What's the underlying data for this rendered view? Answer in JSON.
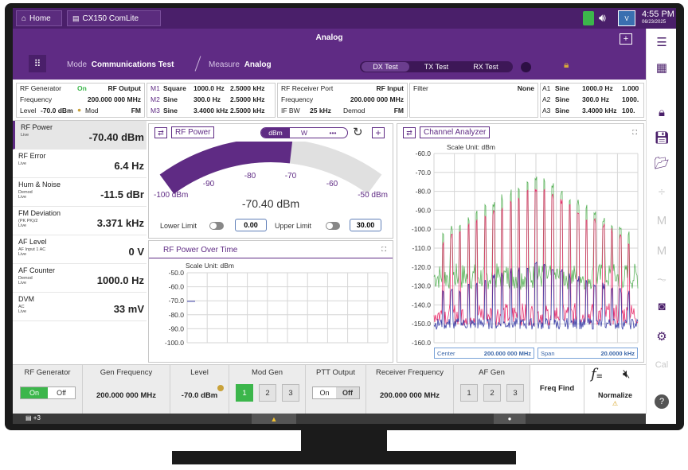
{
  "header": {
    "home_label": "Home",
    "app_tab_label": "CX150 ComLite",
    "time": "4:55 PM",
    "date": "06/23/2025"
  },
  "toolbar": {
    "title": "Analog",
    "mode_label": "Mode",
    "mode_value": "Communications Test",
    "measure_label": "Measure",
    "measure_value": "Analog",
    "tests": [
      "DX Test",
      "TX Test",
      "RX Test"
    ],
    "active_test": "DX Test",
    "plus_label": "+"
  },
  "status": {
    "rf_gen": {
      "label": "RF Generator",
      "state": "On",
      "output_label": "RF Output",
      "freq_label": "Frequency",
      "freq_value": "200.000 000 MHz",
      "level_label": "Level",
      "level_value": "-70.0 dBm",
      "mod_label": "Mod",
      "mod_value": "FM"
    },
    "mods": [
      {
        "id": "M1",
        "shape": "Square",
        "freq": "1000.0 Hz",
        "dev": "2.5000 kHz"
      },
      {
        "id": "M2",
        "shape": "Sine",
        "freq": "300.0 Hz",
        "dev": "2.5000 kHz"
      },
      {
        "id": "M3",
        "shape": "Sine",
        "freq": "3.4000 kHz",
        "dev": "2.5000 kHz"
      }
    ],
    "receiver": {
      "port_label": "RF Receiver Port",
      "port_value": "RF Input",
      "freq_label": "Frequency",
      "freq_value": "200.000 000 MHz",
      "ifbw_label": "IF BW",
      "ifbw_value": "25 kHz",
      "demod_label": "Demod",
      "demod_value": "FM"
    },
    "filter": {
      "label": "Filter",
      "value": "None"
    },
    "audio": [
      {
        "id": "A1",
        "shape": "Sine",
        "freq": "1000.0 Hz",
        "extra": "1.000"
      },
      {
        "id": "A2",
        "shape": "Sine",
        "freq": "300.0 Hz",
        "extra": "1000."
      },
      {
        "id": "A3",
        "shape": "Sine",
        "freq": "3.4000 kHz",
        "extra": "100."
      }
    ]
  },
  "measurements": [
    {
      "name": "RF Power",
      "sub1": "Live",
      "sub2": "",
      "sub3": "",
      "value": "-70.40 dBm"
    },
    {
      "name": "RF Error",
      "sub1": "Live",
      "sub2": "",
      "sub3": "",
      "value": "6.4 Hz"
    },
    {
      "name": "Hum & Noise",
      "sub1": "Demod",
      "sub2": "Live",
      "sub3": "",
      "value": "-11.5 dBr"
    },
    {
      "name": "FM Deviation",
      "sub1": "(PK PK)/2",
      "sub2": "Live",
      "sub3": "",
      "value": "3.371 kHz"
    },
    {
      "name": "AF Level",
      "sub1": "AF Input 1 AC",
      "sub2": "Live",
      "sub3": "",
      "value": "0 V"
    },
    {
      "name": "AF Counter",
      "sub1": "Demod",
      "sub2": "Live",
      "sub3": "",
      "value": "1000.0 Hz"
    },
    {
      "name": "DVM",
      "sub1": "AC",
      "sub2": "Live",
      "sub3": "",
      "value": "33 mV"
    }
  ],
  "rf_power_panel": {
    "title": "RF Power",
    "unit_dbm": "dBm",
    "unit_w": "W",
    "more": "•••",
    "gauge_value": "-70.40 dBm",
    "gauge_min_label": "-100 dBm",
    "gauge_max_label": "-50 dBm",
    "gauge_ticks": [
      "-90",
      "-80",
      "-70",
      "-60"
    ],
    "gauge_fraction": 0.592,
    "lower_limit_label": "Lower Limit",
    "lower_limit_value": "0.00",
    "upper_limit_label": "Upper Limit",
    "upper_limit_value": "30.00"
  },
  "power_over_time": {
    "title": "RF Power Over Time",
    "scale_label": "Scale Unit: dBm",
    "y_ticks": [
      "-50.0",
      "-60.0",
      "-70.0",
      "-80.0",
      "-90.0",
      "-100.0"
    ]
  },
  "channel_analyzer": {
    "title": "Channel Analyzer",
    "scale_label": "Scale Unit: dBm",
    "y_ticks": [
      "-60.0",
      "-70.0",
      "-80.0",
      "-90.0",
      "-100.0",
      "-110.0",
      "-120.0",
      "-130.0",
      "-140.0",
      "-150.0",
      "-160.0"
    ],
    "center_label": "Center",
    "center_value": "200.000 000 MHz",
    "span_label": "Span",
    "span_value": "20.0000 kHz",
    "trace_colors": [
      "#e8316e",
      "#5cb35c",
      "#3b3fa8"
    ]
  },
  "bottom": {
    "rf_gen": {
      "label": "RF Generator",
      "on": "On",
      "off": "Off"
    },
    "gen_freq": {
      "label": "Gen Frequency",
      "value": "200.000 000 MHz"
    },
    "level": {
      "label": "Level",
      "value": "-70.0 dBm"
    },
    "mod_gen": {
      "label": "Mod Gen",
      "buttons": [
        "1",
        "2",
        "3"
      ]
    },
    "ptt": {
      "label": "PTT Output",
      "on": "On",
      "off": "Off"
    },
    "rx_freq": {
      "label": "Receiver Frequency",
      "value": "200.000 000 MHz"
    },
    "af_gen": {
      "label": "AF Gen",
      "buttons": [
        "1",
        "2",
        "3"
      ]
    },
    "freq_find": "Freq Find",
    "normalize": "Normalize",
    "fx": "f"
  },
  "footer": {
    "notif": "+3"
  },
  "sidebar_cal": "Cal",
  "accent": "#5f2b84"
}
